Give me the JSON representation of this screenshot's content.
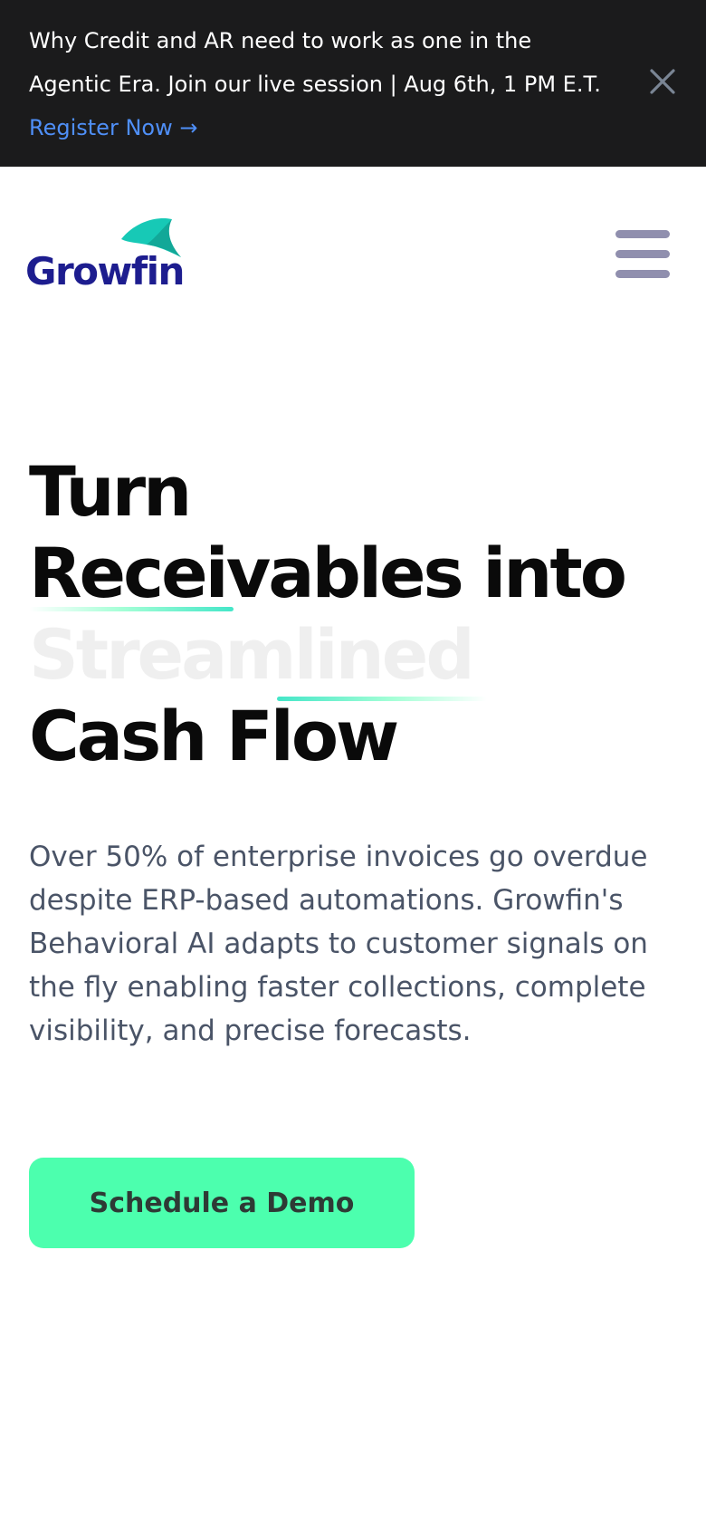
{
  "banner": {
    "message": "Why Credit and AR need to work as one in the Agentic Era. Join our live session | Aug 6th, 1 PM E.T.",
    "link_text": "Register Now →",
    "close_icon": "close-icon"
  },
  "header": {
    "logo_text": "Growfin",
    "menu_icon": "hamburger-menu-icon"
  },
  "hero": {
    "headline": {
      "line1": "Turn",
      "line2": "Receivables into",
      "line3": "Streamlined",
      "line4": "Cash Flow"
    },
    "description": "Over 50% of enterprise invoices go overdue despite ERP-based automations. Growfin's Behavioral AI adapts to customer signals on the fly enabling faster collections, complete visibility, and precise forecasts.",
    "cta_label": "Schedule a Demo"
  },
  "colors": {
    "banner_bg": "#1b1b1c",
    "link": "#4f8ff7",
    "logo_text": "#1d1d8f",
    "logo_mark": "#17c9b6",
    "accent_green": "#4cffae",
    "body_text": "#4a5467",
    "menu_icon": "#908fae"
  }
}
